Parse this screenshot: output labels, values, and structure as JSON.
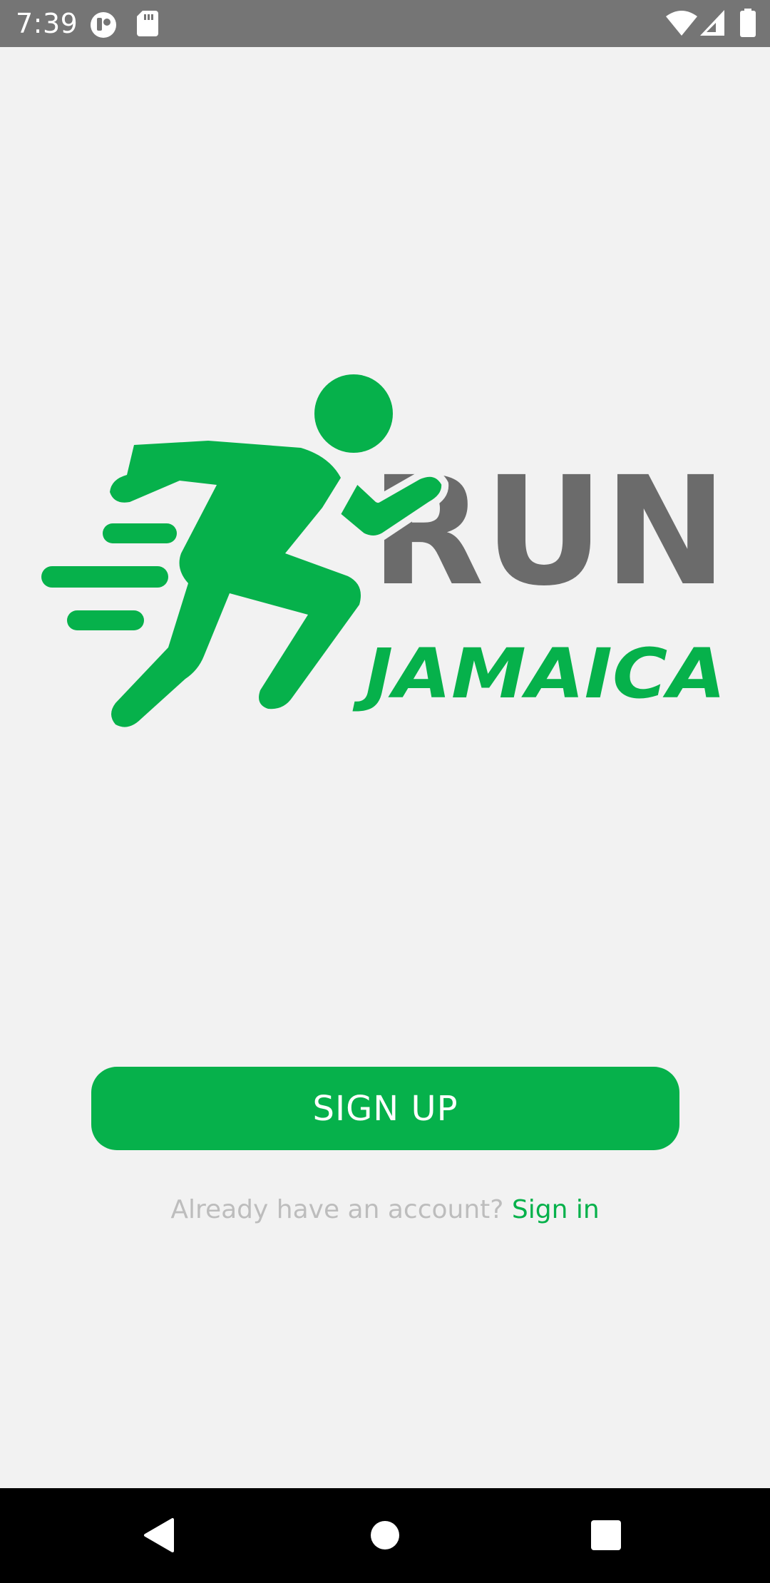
{
  "status_bar": {
    "time": "7:39",
    "icons": [
      "app-notification-icon",
      "sd-card-icon",
      "wifi-icon",
      "cellular-signal-icon",
      "battery-icon"
    ]
  },
  "logo": {
    "title": "RUN",
    "subtitle": "JAMAICA",
    "icon": "runner-icon"
  },
  "signup": {
    "label": "SIGN UP"
  },
  "signin": {
    "prompt": "Already have an account?",
    "link": "Sign in"
  },
  "nav_bar": {
    "buttons": [
      "back-icon",
      "home-icon",
      "recents-icon"
    ]
  },
  "colors": {
    "accent": "#06b14b",
    "text_dark": "#6b6b6b",
    "status_bar": "#757575",
    "background": "#f2f2f2",
    "nav_bar": "#000000",
    "muted_text": "#bdbdbd"
  }
}
